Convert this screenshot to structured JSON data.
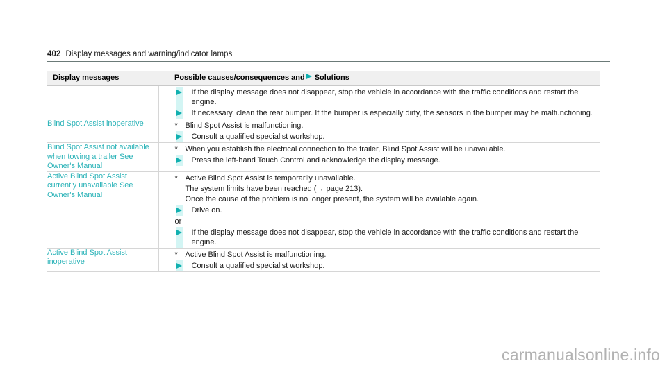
{
  "page": {
    "folio": "402",
    "running_title": "Display messages and warning/indicator lamps"
  },
  "table": {
    "headers": {
      "left": "Display messages",
      "right_before_icon": "Possible causes/consequences and",
      "right_icon": "solution-triangle-icon",
      "right_after_icon": "Solutions"
    },
    "rows": [
      {
        "message": "",
        "lines": [
          {
            "kind": "solution",
            "text": "If the display message does not disappear, stop the vehicle in accordance with the traffic conditions and restart the engine."
          },
          {
            "kind": "solution",
            "text": "If necessary, clean the rear bumper. If the bumper is especially dirty, the sensors in the bumper may be malfunctioning."
          }
        ]
      },
      {
        "message": "Blind Spot Assist inoperative",
        "lines": [
          {
            "kind": "cause",
            "marker": "*",
            "text": "Blind Spot Assist is malfunctioning."
          },
          {
            "kind": "solution",
            "text": "Consult a qualified specialist workshop."
          }
        ]
      },
      {
        "message": "Blind Spot Assist not available when towing a trailer See Owner's Manual",
        "lines": [
          {
            "kind": "cause",
            "marker": "*",
            "text": "When you establish the electrical connection to the trailer, Blind Spot Assist will be unavailable."
          },
          {
            "kind": "solution",
            "text": "Press the left-hand Touch Control and acknowledge the display message."
          }
        ]
      },
      {
        "message": "Active Blind Spot Assist currently unavailable See Owner's Manual",
        "lines": [
          {
            "kind": "cause",
            "marker": "*",
            "text": "Active Blind Spot Assist is temporarily unavailable."
          },
          {
            "kind": "plain",
            "text": "The system limits have been reached (→ page 213)."
          },
          {
            "kind": "plain",
            "text": "Once the cause of the problem is no longer present, the system will be available again."
          },
          {
            "kind": "solution",
            "text": "Drive on."
          },
          {
            "kind": "or",
            "text": "or"
          },
          {
            "kind": "solution",
            "text": "If the display message does not disappear, stop the vehicle in accordance with the traffic conditions and restart the engine."
          }
        ]
      },
      {
        "message": "Active Blind Spot Assist inoperative",
        "lines": [
          {
            "kind": "cause",
            "marker": "*",
            "text": "Active Blind Spot Assist is malfunctioning."
          },
          {
            "kind": "solution",
            "text": "Consult a qualified specialist workshop."
          }
        ]
      }
    ]
  },
  "watermark": {
    "text": "carmanualsonline.info"
  },
  "colors": {
    "accent_teal": "#11b0b0",
    "message_text": "#2bb3b8",
    "strip": "#d3f5f4",
    "header_bg": "#f0f0f0",
    "rule": "#d6d6d6",
    "watermark": "#b2b2b2"
  }
}
